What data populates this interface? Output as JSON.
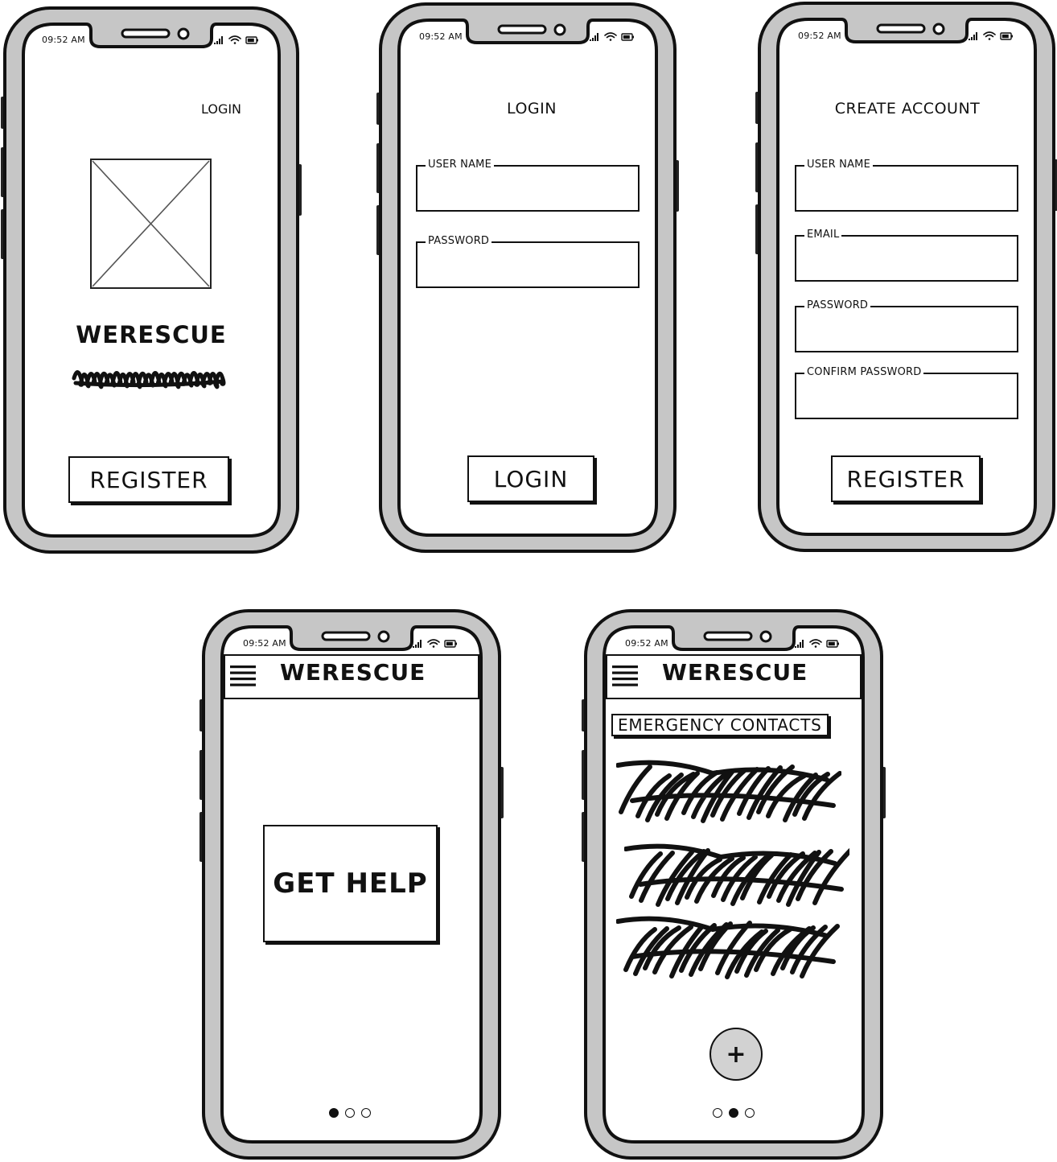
{
  "status": {
    "time": "09:52 AM"
  },
  "screens": {
    "welcome": {
      "login_link": "LOGIN",
      "brand": "WERESCUE",
      "register_label": "REGISTER"
    },
    "login": {
      "title": "LOGIN",
      "fields": [
        "USER NAME",
        "PASSWORD"
      ],
      "login_label": "LOGIN"
    },
    "create_account": {
      "title": "CREATE ACCOUNT",
      "fields": [
        "USER NAME",
        "EMAIL",
        "PASSWORD",
        "CONFIRM PASSWORD"
      ],
      "register_label": "REGISTER"
    },
    "home": {
      "header_title": "WERESCUE",
      "get_help_label": "GET HELP",
      "active_page": 1,
      "page_count": 3
    },
    "contacts": {
      "header_title": "WERESCUE",
      "section_title": "EMERGENCY CONTACTS",
      "add_label": "+",
      "active_page": 2,
      "page_count": 3
    }
  }
}
